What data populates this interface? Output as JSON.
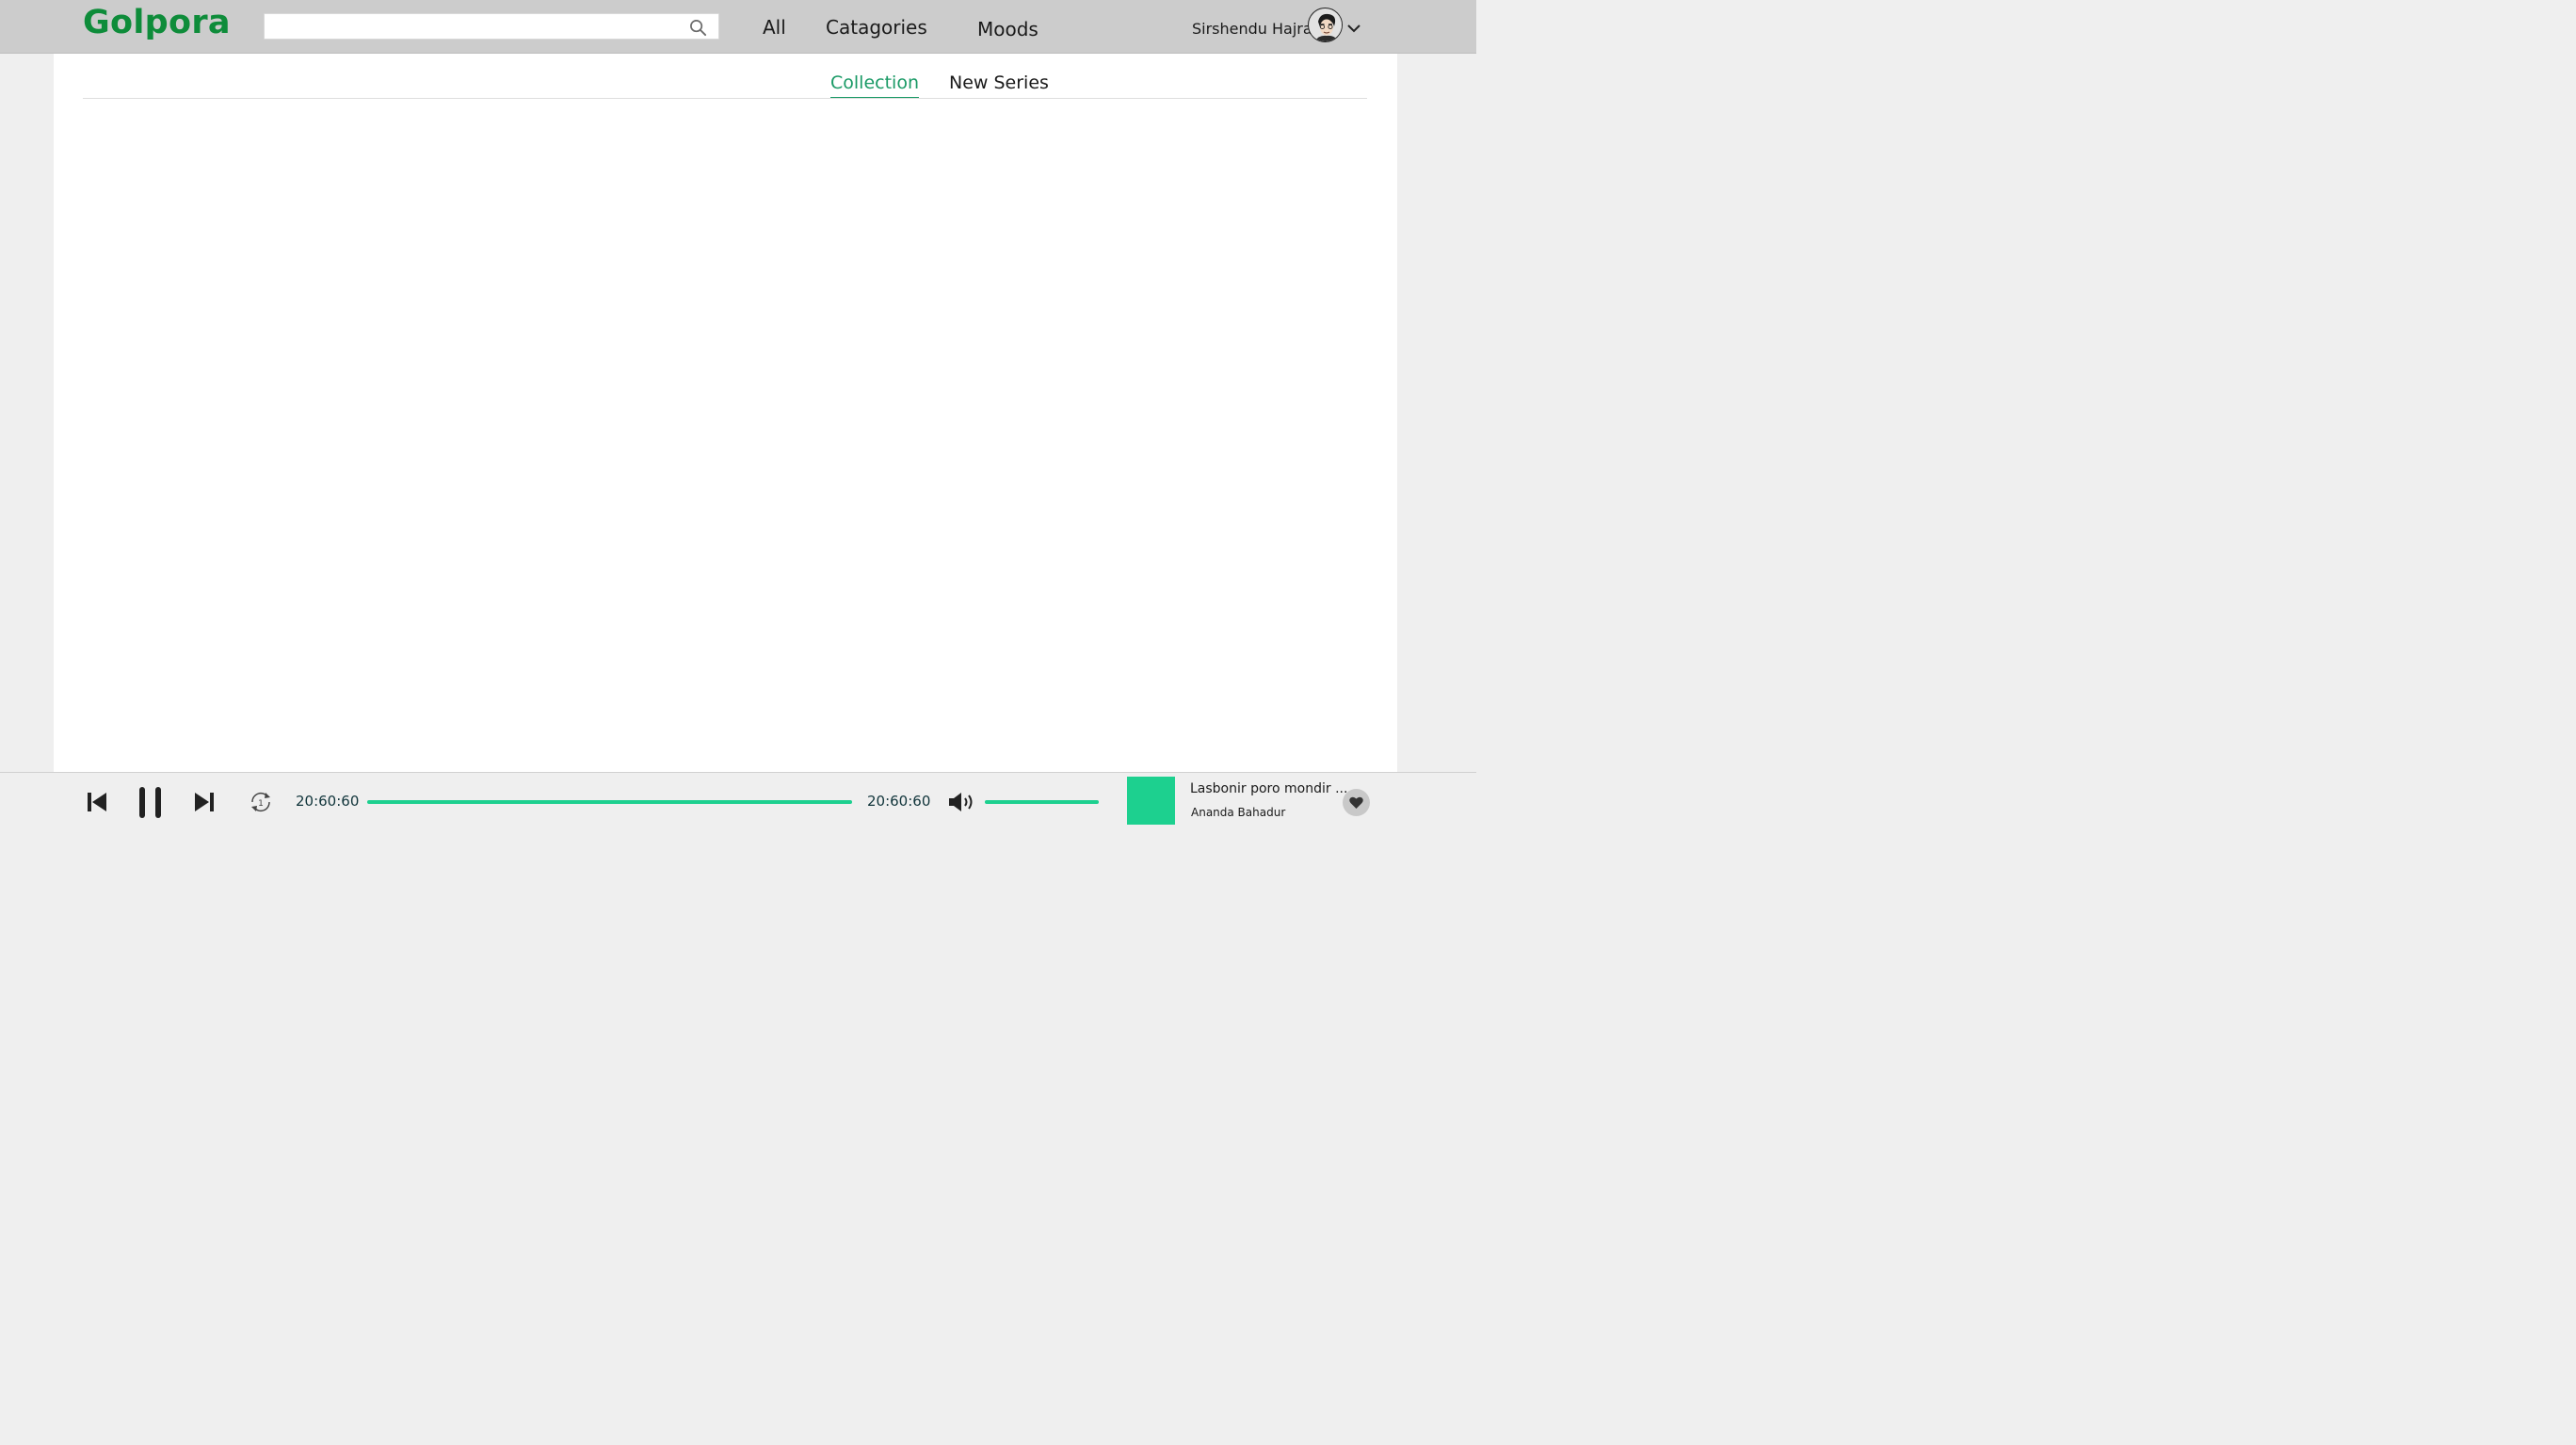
{
  "header": {
    "logo": "Golpora",
    "search": {
      "value": "",
      "placeholder": ""
    },
    "nav": [
      "All",
      "Catagories",
      "Moods"
    ],
    "user": {
      "name": "Sirshendu Hajra"
    }
  },
  "content": {
    "tabs": [
      {
        "label": "Collection",
        "active": true
      },
      {
        "label": "New Series",
        "active": false
      }
    ]
  },
  "player": {
    "elapsed": "20:60:60",
    "total": "20:60:60",
    "progress_fraction": 1.0,
    "volume_fraction": 1.0,
    "loop_badge": "1",
    "track": {
      "title": "Lasbonir poro mondir ...",
      "artist": "Ananda Bahadur"
    }
  },
  "colors": {
    "brand_green": "#0e8c3a",
    "accent_teal": "#1a9a66",
    "progress_green": "#1dd08f",
    "header_bg": "#cccccc"
  },
  "icons": [
    "search-icon",
    "chevron-down-icon",
    "previous-icon",
    "pause-icon",
    "next-icon",
    "repeat-once-icon",
    "volume-icon",
    "heart-icon"
  ]
}
